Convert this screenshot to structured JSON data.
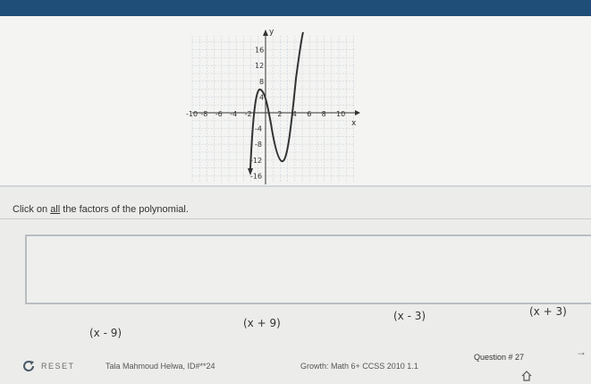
{
  "graph": {
    "y_axis_label": "y",
    "x_axis_label": "x",
    "x_ticks": [
      "-10",
      "-8",
      "-6",
      "-4",
      "-2",
      "2",
      "4",
      "6",
      "8",
      "10"
    ],
    "y_ticks": [
      "16",
      "12",
      "8",
      "4",
      "-4",
      "-8",
      "-12",
      "-16"
    ]
  },
  "question": {
    "prompt_before": "Click on ",
    "prompt_highlight": "all",
    "prompt_after": " the factors of the polynomial."
  },
  "choices": [
    {
      "label": "(x - 9)"
    },
    {
      "label": "(x + 9)"
    },
    {
      "label": "(x - 3)"
    },
    {
      "label": "(x + 3)"
    }
  ],
  "footer": {
    "reset_label": "RESET",
    "student": "Tala Mahmoud Helwa, ID#**24",
    "growth": "Growth: Math 6+ CCSS 2010 1.1",
    "question_number": "Question # 27",
    "next_icon": "arrow-right-icon",
    "home_icon": "home-icon"
  },
  "colors": {
    "top_bar": "#1f4e79",
    "curve": "#333333",
    "grid": "#c9d4dc"
  }
}
